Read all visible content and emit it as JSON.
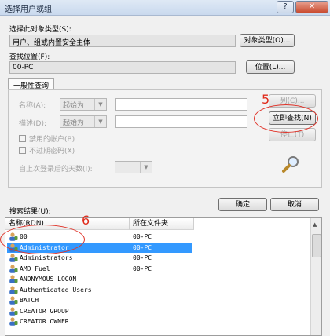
{
  "window": {
    "title": "选择用户或组",
    "help_glyph": "?",
    "close_glyph": "✕"
  },
  "object_type": {
    "label": "选择此对象类型(S):",
    "value": "用户、组或内置安全主体",
    "button": "对象类型(O)..."
  },
  "location": {
    "label": "查找位置(F):",
    "value": "00-PC",
    "button": "位置(L)..."
  },
  "query": {
    "tab": "一般性查询",
    "name_label": "名称(A):",
    "name_mode": "起始为",
    "desc_label": "描述(D):",
    "desc_mode": "起始为",
    "disabled_accounts": "禁用的帐户(B)",
    "non_expiring": "不过期密码(X)",
    "days_label": "自上次登录后的天数(I):",
    "columns_button": "列(C)...",
    "find_now_button": "立即查找(N)",
    "stop_button": "停止(T)"
  },
  "actions": {
    "ok": "确定",
    "cancel": "取消"
  },
  "results": {
    "label": "搜索结果(U):",
    "columns": [
      "名称(RDN)",
      "所在文件夹"
    ],
    "rows": [
      {
        "name": "00",
        "folder": "00-PC",
        "selected": false
      },
      {
        "name": "Administrator",
        "folder": "00-PC",
        "selected": true
      },
      {
        "name": "Administrators",
        "folder": "00-PC",
        "selected": false
      },
      {
        "name": "AMD Fuel",
        "folder": "00-PC",
        "selected": false
      },
      {
        "name": "ANONYMOUS LOGON",
        "folder": "",
        "selected": false
      },
      {
        "name": "Authenticated Users",
        "folder": "",
        "selected": false
      },
      {
        "name": "BATCH",
        "folder": "",
        "selected": false
      },
      {
        "name": "CREATOR GROUP",
        "folder": "",
        "selected": false
      },
      {
        "name": "CREATOR OWNER",
        "folder": "",
        "selected": false
      }
    ]
  },
  "annotations": {
    "step5": "5",
    "step6": "6"
  },
  "colors": {
    "selection": "#3399ff",
    "annotation": "#e0342a"
  }
}
